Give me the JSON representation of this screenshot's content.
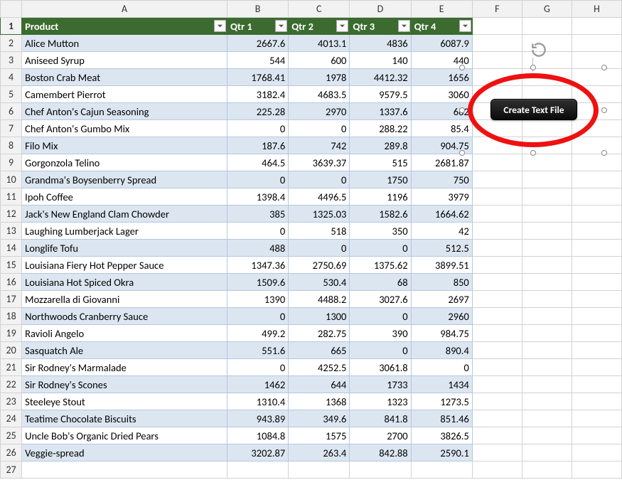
{
  "columns": [
    "A",
    "B",
    "C",
    "D",
    "E",
    "F",
    "G",
    "H"
  ],
  "header": {
    "product": "Product",
    "q1": "Qtr 1",
    "q2": "Qtr 2",
    "q3": "Qtr 3",
    "q4": "Qtr 4"
  },
  "rows": [
    {
      "product": "Alice Mutton",
      "q1": "2667.6",
      "q2": "4013.1",
      "q3": "4836",
      "q4": "6087.9"
    },
    {
      "product": "Aniseed Syrup",
      "q1": "544",
      "q2": "600",
      "q3": "140",
      "q4": "440"
    },
    {
      "product": "Boston Crab Meat",
      "q1": "1768.41",
      "q2": "1978",
      "q3": "4412.32",
      "q4": "1656"
    },
    {
      "product": "Camembert Pierrot",
      "q1": "3182.4",
      "q2": "4683.5",
      "q3": "9579.5",
      "q4": "3060"
    },
    {
      "product": "Chef Anton's Cajun Seasoning",
      "q1": "225.28",
      "q2": "2970",
      "q3": "1337.6",
      "q4": "682"
    },
    {
      "product": "Chef Anton's Gumbo Mix",
      "q1": "0",
      "q2": "0",
      "q3": "288.22",
      "q4": "85.4"
    },
    {
      "product": "Filo Mix",
      "q1": "187.6",
      "q2": "742",
      "q3": "289.8",
      "q4": "904.75"
    },
    {
      "product": "Gorgonzola Telino",
      "q1": "464.5",
      "q2": "3639.37",
      "q3": "515",
      "q4": "2681.87"
    },
    {
      "product": "Grandma's Boysenberry Spread",
      "q1": "0",
      "q2": "0",
      "q3": "1750",
      "q4": "750"
    },
    {
      "product": "Ipoh Coffee",
      "q1": "1398.4",
      "q2": "4496.5",
      "q3": "1196",
      "q4": "3979"
    },
    {
      "product": "Jack's New England Clam Chowder",
      "q1": "385",
      "q2": "1325.03",
      "q3": "1582.6",
      "q4": "1664.62"
    },
    {
      "product": "Laughing Lumberjack Lager",
      "q1": "0",
      "q2": "518",
      "q3": "350",
      "q4": "42"
    },
    {
      "product": "Longlife Tofu",
      "q1": "488",
      "q2": "0",
      "q3": "0",
      "q4": "512.5"
    },
    {
      "product": "Louisiana Fiery Hot Pepper Sauce",
      "q1": "1347.36",
      "q2": "2750.69",
      "q3": "1375.62",
      "q4": "3899.51"
    },
    {
      "product": "Louisiana Hot Spiced Okra",
      "q1": "1509.6",
      "q2": "530.4",
      "q3": "68",
      "q4": "850"
    },
    {
      "product": "Mozzarella di Giovanni",
      "q1": "1390",
      "q2": "4488.2",
      "q3": "3027.6",
      "q4": "2697"
    },
    {
      "product": "Northwoods Cranberry Sauce",
      "q1": "0",
      "q2": "1300",
      "q3": "0",
      "q4": "2960"
    },
    {
      "product": "Ravioli Angelo",
      "q1": "499.2",
      "q2": "282.75",
      "q3": "390",
      "q4": "984.75"
    },
    {
      "product": "Sasquatch Ale",
      "q1": "551.6",
      "q2": "665",
      "q3": "0",
      "q4": "890.4"
    },
    {
      "product": "Sir Rodney's Marmalade",
      "q1": "0",
      "q2": "4252.5",
      "q3": "3061.8",
      "q4": "0"
    },
    {
      "product": "Sir Rodney's Scones",
      "q1": "1462",
      "q2": "644",
      "q3": "1733",
      "q4": "1434"
    },
    {
      "product": "Steeleye Stout",
      "q1": "1310.4",
      "q2": "1368",
      "q3": "1323",
      "q4": "1273.5"
    },
    {
      "product": "Teatime Chocolate Biscuits",
      "q1": "943.89",
      "q2": "349.6",
      "q3": "841.8",
      "q4": "851.46"
    },
    {
      "product": "Uncle Bob's Organic Dried Pears",
      "q1": "1084.8",
      "q2": "1575",
      "q3": "2700",
      "q4": "3826.5"
    },
    {
      "product": "Veggie-spread",
      "q1": "3202.87",
      "q2": "263.4",
      "q3": "842.88",
      "q4": "2590.1"
    }
  ],
  "button_label": "Create Text File"
}
